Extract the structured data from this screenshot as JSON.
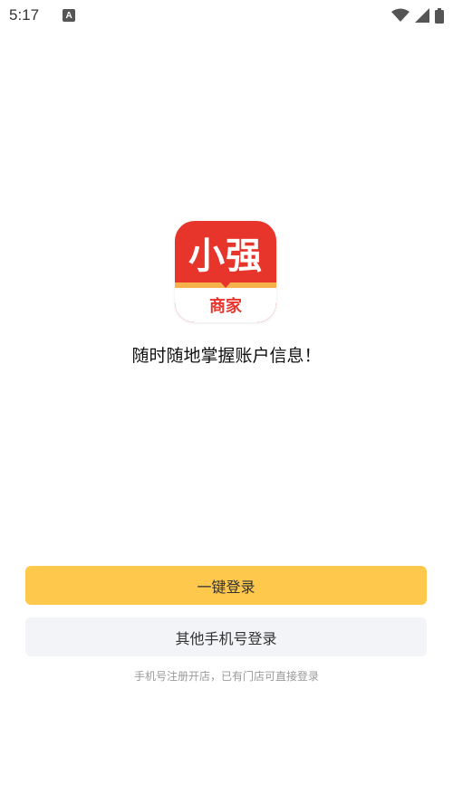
{
  "status_bar": {
    "time": "5:17",
    "notification_icon_letter": "A"
  },
  "logo": {
    "title": "小强",
    "subtitle": "商家",
    "colors": {
      "red": "#e8352c",
      "band": "#f6b24a"
    }
  },
  "slogan": "随时随地掌握账户信息！",
  "buttons": {
    "one_click_login": "一键登录",
    "other_phone_login": "其他手机号登录"
  },
  "hint": "手机号注册开店，已有门店可直接登录",
  "colors": {
    "primary_button": "#fdc84c",
    "secondary_button": "#f3f4f7"
  }
}
